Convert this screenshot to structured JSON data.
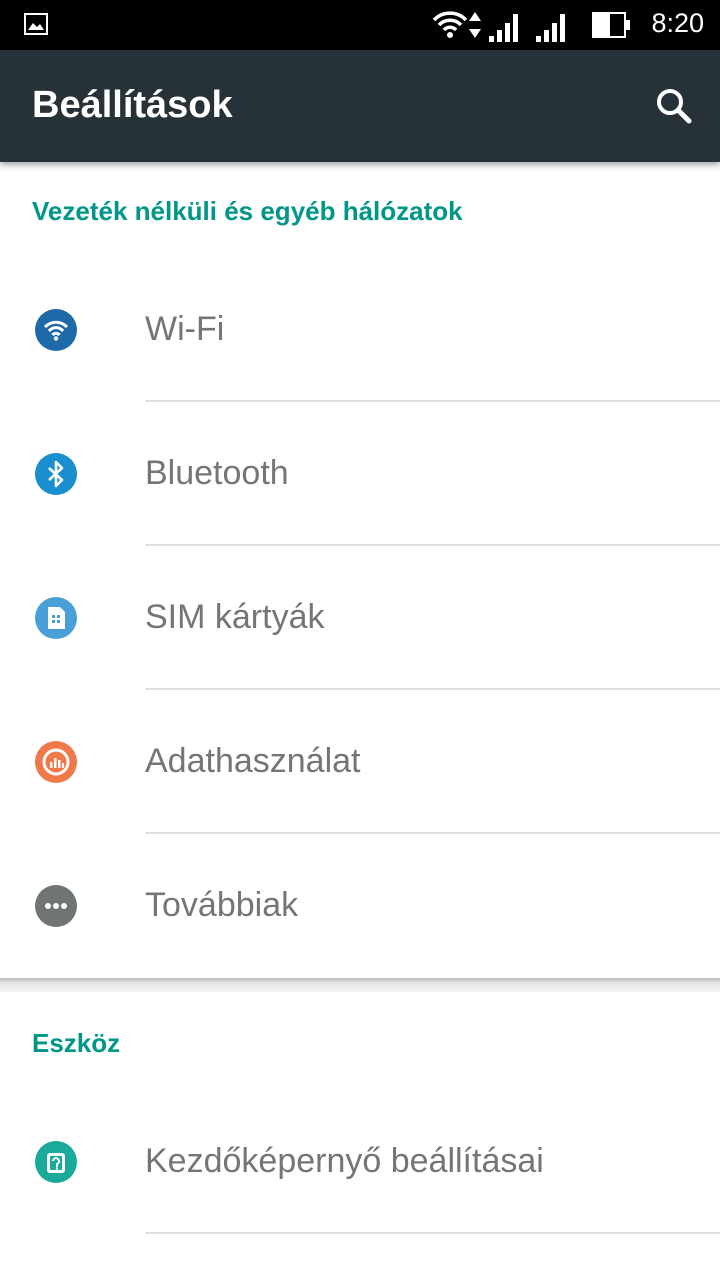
{
  "status_bar": {
    "time": "8:20",
    "icons": [
      "image-notification-icon",
      "wifi-icon",
      "data-activity-icon",
      "signal-icon",
      "signal-icon",
      "battery-icon"
    ]
  },
  "action_bar": {
    "title": "Beállítások",
    "search_icon": "search-icon"
  },
  "colors": {
    "accent": "#009688",
    "toolbar": "#263238",
    "wifi": "#1e6aa8",
    "bluetooth": "#1a8fd0",
    "sim": "#4a9fd8",
    "data_usage": "#f0794a",
    "more": "#6f7572",
    "home": "#1aa99a"
  },
  "sections": [
    {
      "header": "Vezeték nélküli és egyéb hálózatok",
      "items": [
        {
          "label": "Wi-Fi",
          "icon": "wifi-icon"
        },
        {
          "label": "Bluetooth",
          "icon": "bluetooth-icon"
        },
        {
          "label": "SIM kártyák",
          "icon": "sim-card-icon"
        },
        {
          "label": "Adathasználat",
          "icon": "data-usage-icon"
        },
        {
          "label": "Továbbiak",
          "icon": "more-icon"
        }
      ]
    },
    {
      "header": "Eszköz",
      "items": [
        {
          "label": "Kezdőképernyő beállításai",
          "icon": "home-settings-icon"
        }
      ]
    }
  ]
}
